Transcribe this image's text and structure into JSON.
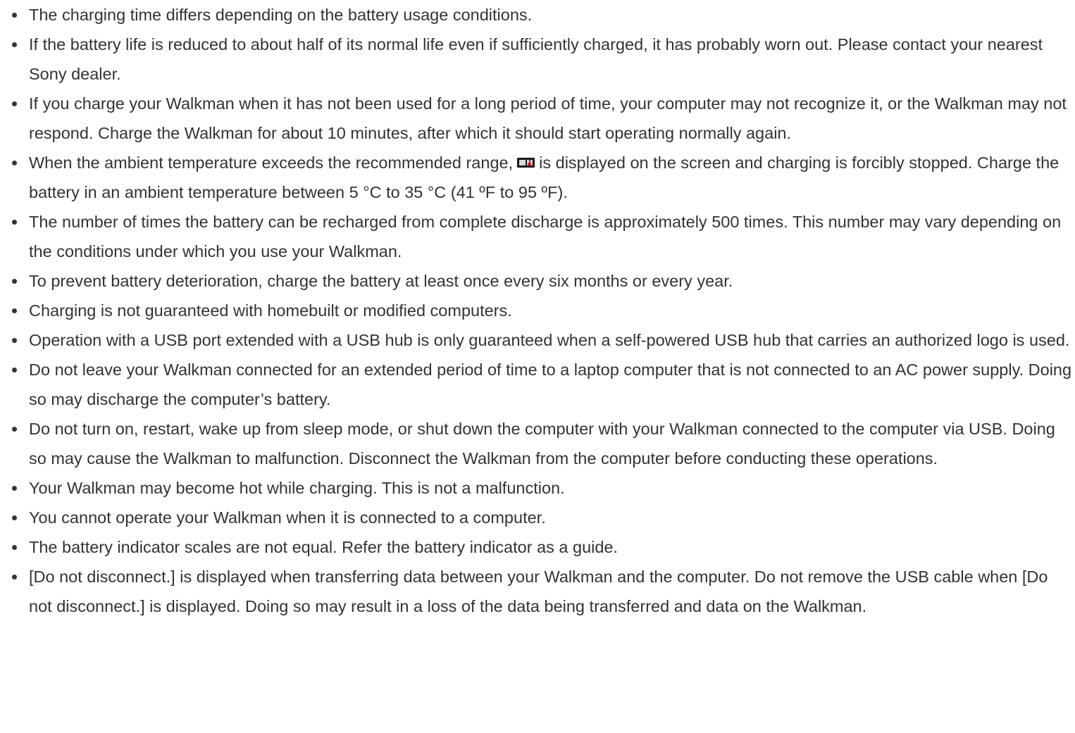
{
  "notes": [
    "The charging time differs depending on the battery usage conditions.",
    "If the battery life is reduced to about half of its normal life even if sufficiently charged, it has probably worn out. Please contact your nearest Sony dealer.",
    "If you charge your Walkman when it has not been used for a long period of time, your computer may not recognize it, or the Walkman may not respond. Charge the Walkman for about 10 minutes, after which it should start operating normally again.",
    {
      "before_icon": "When the ambient temperature exceeds the recommended range,",
      "icon": "battery-temperature-warning-icon",
      "after_icon": "is displayed on the screen and charging is forcibly stopped. Charge the battery in an ambient temperature between 5 °C to 35 °C (41 ºF to 95 ºF)."
    },
    "The number of times the battery can be recharged from complete discharge is approximately 500 times. This number may vary depending on the conditions under which you use your Walkman.",
    "To prevent battery deterioration, charge the battery at least once every six months or every year.",
    "Charging is not guaranteed with homebuilt or modified computers.",
    "Operation with a USB port extended with a USB hub is only guaranteed when a self-powered USB hub that carries an authorized logo is used.",
    "Do not leave your Walkman connected for an extended period of time to a laptop computer that is not connected to an AC power supply. Doing so may discharge the computer’s battery.",
    "Do not turn on, restart, wake up from sleep mode, or shut down the computer with your Walkman connected to the computer via USB. Doing so may cause the Walkman to malfunction. Disconnect the Walkman from the computer before conducting these operations.",
    "Your Walkman may become hot while charging. This is not a malfunction.",
    "You cannot operate your Walkman when it is connected to a computer.",
    "The battery indicator scales are not equal. Refer the battery indicator as a guide.",
    "[Do not disconnect.] is displayed when transferring data between your Walkman and the computer. Do not remove the USB cable when [Do not disconnect.] is displayed. Doing so may result in a loss of the data being transferred and data on the Walkman."
  ],
  "colors": {
    "text": "#333333",
    "background": "#ffffff",
    "icon_warning": "#dd1111"
  }
}
